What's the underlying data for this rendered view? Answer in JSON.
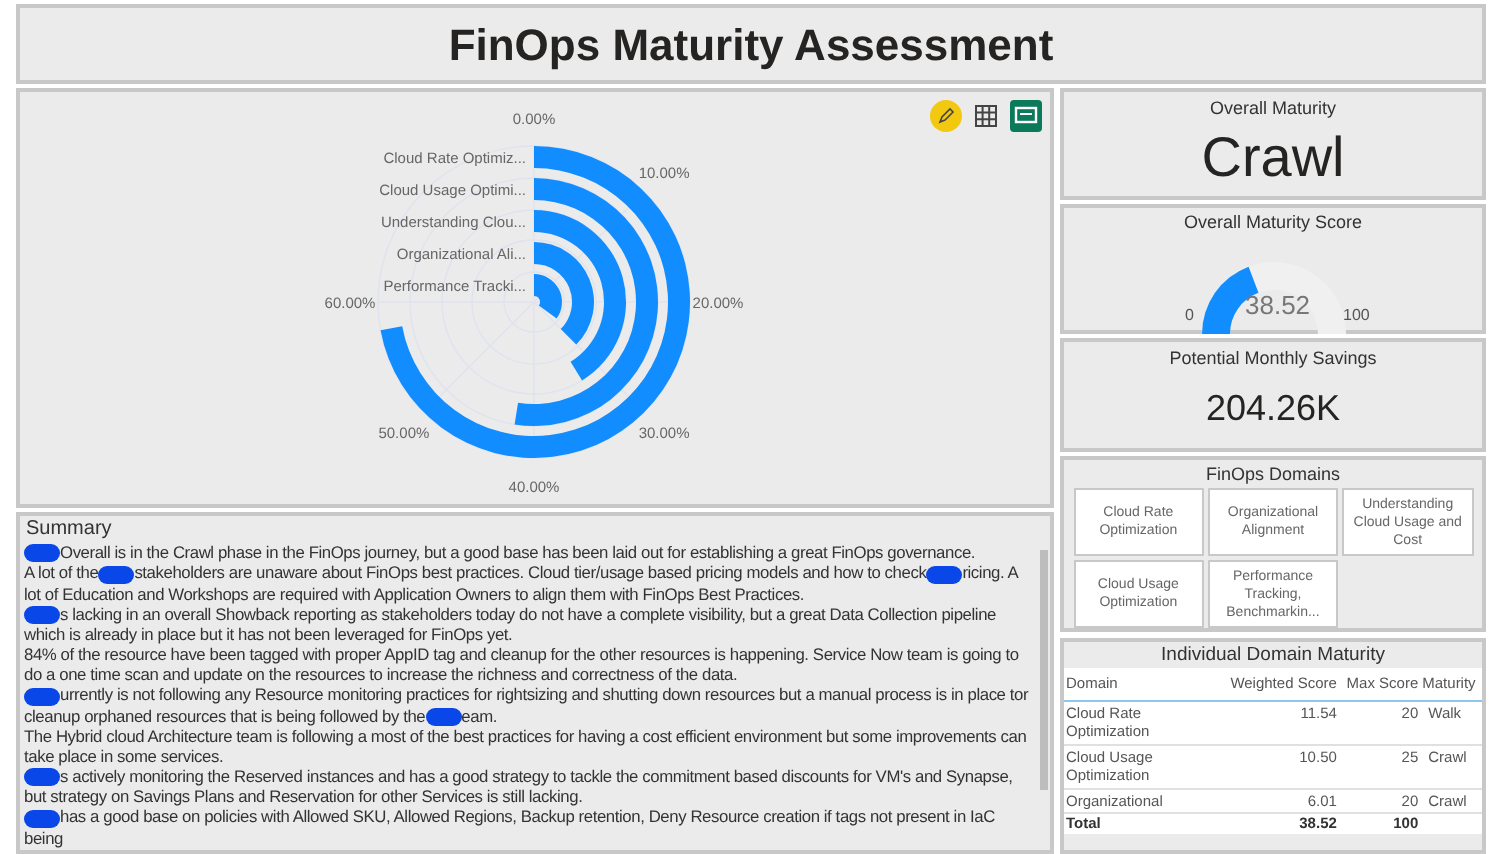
{
  "title": "FinOps Maturity Assessment",
  "chart_panel": {
    "toolbar": [
      {
        "kind": "pencil"
      },
      {
        "kind": "grid"
      },
      {
        "kind": "comment"
      }
    ],
    "radial_chart": {
      "bar_labels": [
        "Cloud Rate Optimiz...",
        "Cloud Usage Optimi...",
        "Understanding Clou...",
        "Organizational Ali...",
        "Performance Tracki..."
      ],
      "scale_labels": [
        "0.00%",
        "10.00%",
        "20.00%",
        "30.00%",
        "40.00%",
        "50.00%",
        "60.00%"
      ]
    }
  },
  "summary": {
    "title": "Summary",
    "paragraphs": [
      [
        {
          "kind": "redaction"
        },
        {
          "kind": "text",
          "text": "Overall is in the Crawl phase in the FinOps journey, but a good base has been laid out for establishing a great FinOps governance."
        }
      ],
      [
        {
          "kind": "text",
          "text": "A lot of the"
        },
        {
          "kind": "redaction"
        },
        {
          "kind": "text",
          "text": "stakeholders are unaware about FinOps best practices. Cloud tier/usage based pricing models and how to check"
        },
        {
          "kind": "redaction"
        },
        {
          "kind": "text",
          "text": "ricing. A lot of Education and Workshops are required with Application Owners to align them with FinOps Best Practices."
        }
      ],
      [
        {
          "kind": "redaction"
        },
        {
          "kind": "text",
          "text": "s lacking in an overall Showback reporting as stakeholders today do not have a complete visibility, but a great Data Collection pipeline which is already in place but it has not been leveraged for FinOps yet."
        }
      ],
      [
        {
          "kind": "text",
          "text": "84% of the resource have been tagged with proper AppID tag and cleanup for the other resources is happening. Service Now team is going to do a one time scan and update on the resources to increase the richness and correctness of the data."
        }
      ],
      [
        {
          "kind": "redaction"
        },
        {
          "kind": "text",
          "text": "urrently is not following any Resource monitoring practices for rightsizing and shutting down resources but a manual process is in place tor cleanup orphaned resources that is being followed by the"
        },
        {
          "kind": "redaction"
        },
        {
          "kind": "text",
          "text": "eam."
        }
      ],
      [
        {
          "kind": "text",
          "text": "The Hybrid cloud Architecture team is following a most of the best practices for having a cost efficient environment but some improvements can take place in some services."
        }
      ],
      [
        {
          "kind": "redaction"
        },
        {
          "kind": "text",
          "text": "s actively monitoring the Reserved instances and has a good strategy to tackle the commitment based discounts for VM's and Synapse, but strategy on Savings Plans and Reservation for other Services is still lacking."
        }
      ],
      [
        {
          "kind": "redaction"
        },
        {
          "kind": "text",
          "text": "has a good base on policies with Allowed SKU, Allowed Regions, Backup retention, Deny Resource creation if tags not present in IaC being"
        }
      ]
    ]
  },
  "overall_maturity": {
    "title": "Overall Maturity",
    "value": "Crawl"
  },
  "maturity_score": {
    "title": "Overall Maturity Score",
    "value": "38.52",
    "min": "0",
    "max": "100"
  },
  "savings": {
    "title": "Potential Monthly Savings",
    "value": "204.26K"
  },
  "domains": {
    "title": "FinOps Domains",
    "items": [
      "Cloud Rate Optimization",
      "Organizational Alignment",
      "Understanding Cloud Usage and Cost",
      "Cloud Usage Optimization",
      "Performance Tracking, Benchmarkin..."
    ]
  },
  "domain_table": {
    "title": "Individual Domain Maturity",
    "columns": [
      "Domain",
      "Weighted Score",
      "Max Score",
      "Maturity"
    ],
    "rows": [
      [
        "Cloud Rate Optimization",
        "11.54",
        "20",
        "Walk"
      ],
      [
        "Cloud Usage Optimization",
        "10.50",
        "25",
        "Crawl"
      ],
      [
        "Organizational",
        "6.01",
        "20",
        "Crawl"
      ]
    ],
    "total": [
      "Total",
      "38.52",
      "100"
    ]
  }
}
